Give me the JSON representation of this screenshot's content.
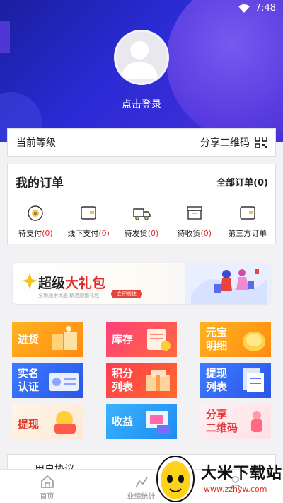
{
  "status": {
    "time": "7:48"
  },
  "profile": {
    "login_label": "点击登录"
  },
  "level": {
    "label": "当前等级",
    "share_label": "分享二维码"
  },
  "orders": {
    "title": "我的订单",
    "all_label": "全部订单(0)",
    "items": [
      {
        "label": "待支付",
        "count": "(0)",
        "icon": "yen-clock-icon"
      },
      {
        "label": "线下支付",
        "count": "(0)",
        "icon": "wallet-icon"
      },
      {
        "label": "待发货",
        "count": "(0)",
        "icon": "truck-icon"
      },
      {
        "label": "待收货",
        "count": "(0)",
        "icon": "box-icon"
      },
      {
        "label": "第三方订单",
        "count": "",
        "icon": "wallet-icon"
      }
    ]
  },
  "banner": {
    "title_a": "超级",
    "title_b": "大礼包",
    "subtitle": "全场通用优惠 精选超值礼包",
    "cta": "立即前往"
  },
  "grid": [
    {
      "label_1": "进货",
      "label_2": ""
    },
    {
      "label_1": "库存",
      "label_2": ""
    },
    {
      "label_1": "元宝",
      "label_2": "明细"
    },
    {
      "label_1": "实名",
      "label_2": "认证"
    },
    {
      "label_1": "积分",
      "label_2": "列表"
    },
    {
      "label_1": "提现",
      "label_2": "列表"
    },
    {
      "label_1": "提现",
      "label_2": ""
    },
    {
      "label_1": "收益",
      "label_2": ""
    },
    {
      "label_1": "分享",
      "label_2": "二维码"
    }
  ],
  "user_block": {
    "label": "用户协议"
  },
  "tabs": [
    {
      "label": "首页",
      "icon": "home-icon"
    },
    {
      "label": "业绩统计",
      "icon": "chart-icon"
    },
    {
      "label": "",
      "icon": "user-icon"
    }
  ],
  "watermark": {
    "name": "大米下载站",
    "url": "www.zzhyw.com"
  },
  "colors": {
    "primary": "#2b2bd6",
    "accent_red": "#e0262a"
  }
}
